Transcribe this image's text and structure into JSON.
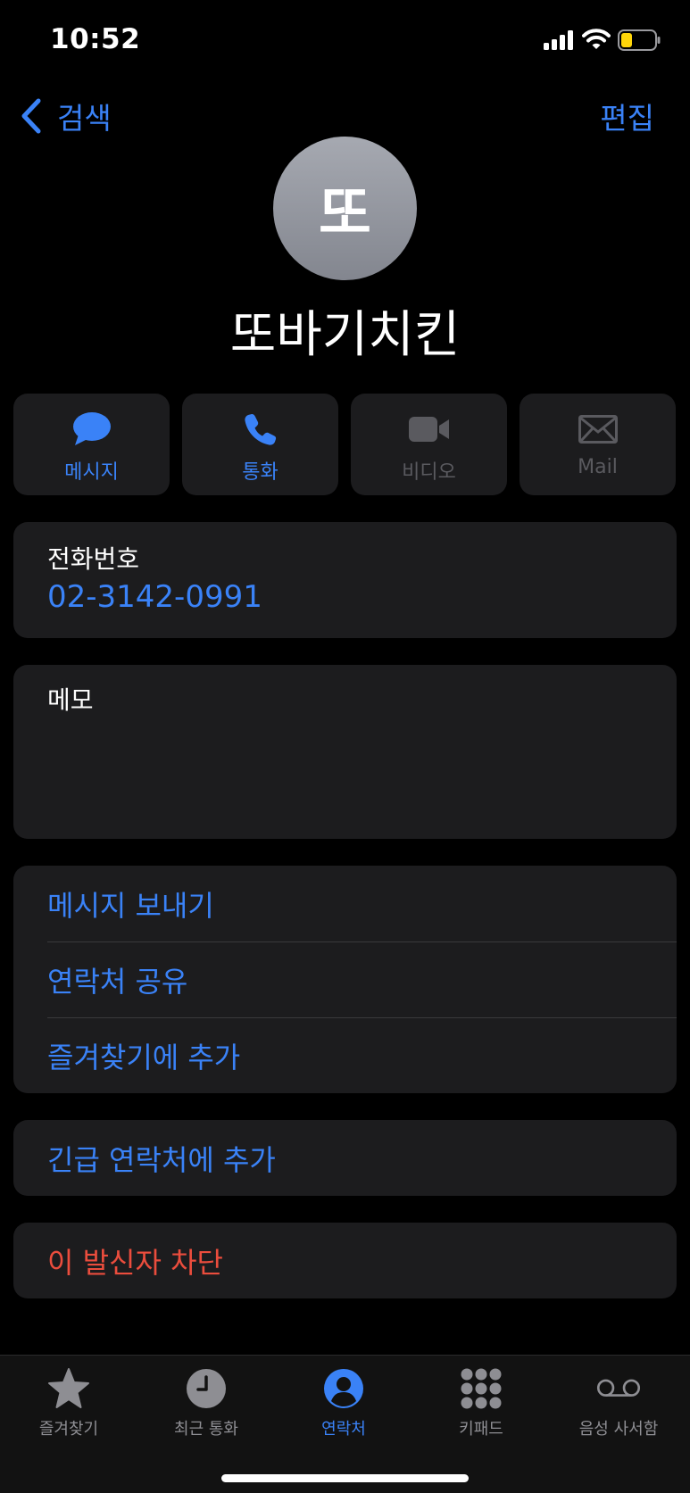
{
  "status_bar": {
    "time": "10:52"
  },
  "nav": {
    "back_label": "검색",
    "edit_label": "편집"
  },
  "contact": {
    "avatar_initial": "또",
    "name": "또바기치킨"
  },
  "actions": [
    {
      "label": "메시지",
      "icon": "message-bubble-icon",
      "enabled": true
    },
    {
      "label": "통화",
      "icon": "phone-icon",
      "enabled": true
    },
    {
      "label": "비디오",
      "icon": "video-camera-icon",
      "enabled": false
    },
    {
      "label": "Mail",
      "icon": "mail-icon",
      "enabled": false
    }
  ],
  "phone": {
    "label": "전화번호",
    "number": "02-3142-0991"
  },
  "memo": {
    "label": "메모"
  },
  "options": [
    {
      "label": "메시지 보내기"
    },
    {
      "label": "연락처 공유"
    },
    {
      "label": "즐겨찾기에 추가"
    }
  ],
  "emergency": {
    "label": "긴급 연락처에 추가"
  },
  "block": {
    "label": "이 발신자 차단"
  },
  "tabbar": {
    "active": "연락처",
    "tabs": [
      {
        "label": "즐겨찾기",
        "icon": "star-icon"
      },
      {
        "label": "최근 통화",
        "icon": "clock-icon"
      },
      {
        "label": "연락처",
        "icon": "person-circle-icon"
      },
      {
        "label": "키패드",
        "icon": "keypad-icon"
      },
      {
        "label": "음성 사서함",
        "icon": "voicemail-icon"
      }
    ]
  },
  "colors": {
    "accent": "#3a82f7",
    "destructive": "#eb4d3d",
    "card": "#1c1c1e",
    "background": "#000000"
  }
}
